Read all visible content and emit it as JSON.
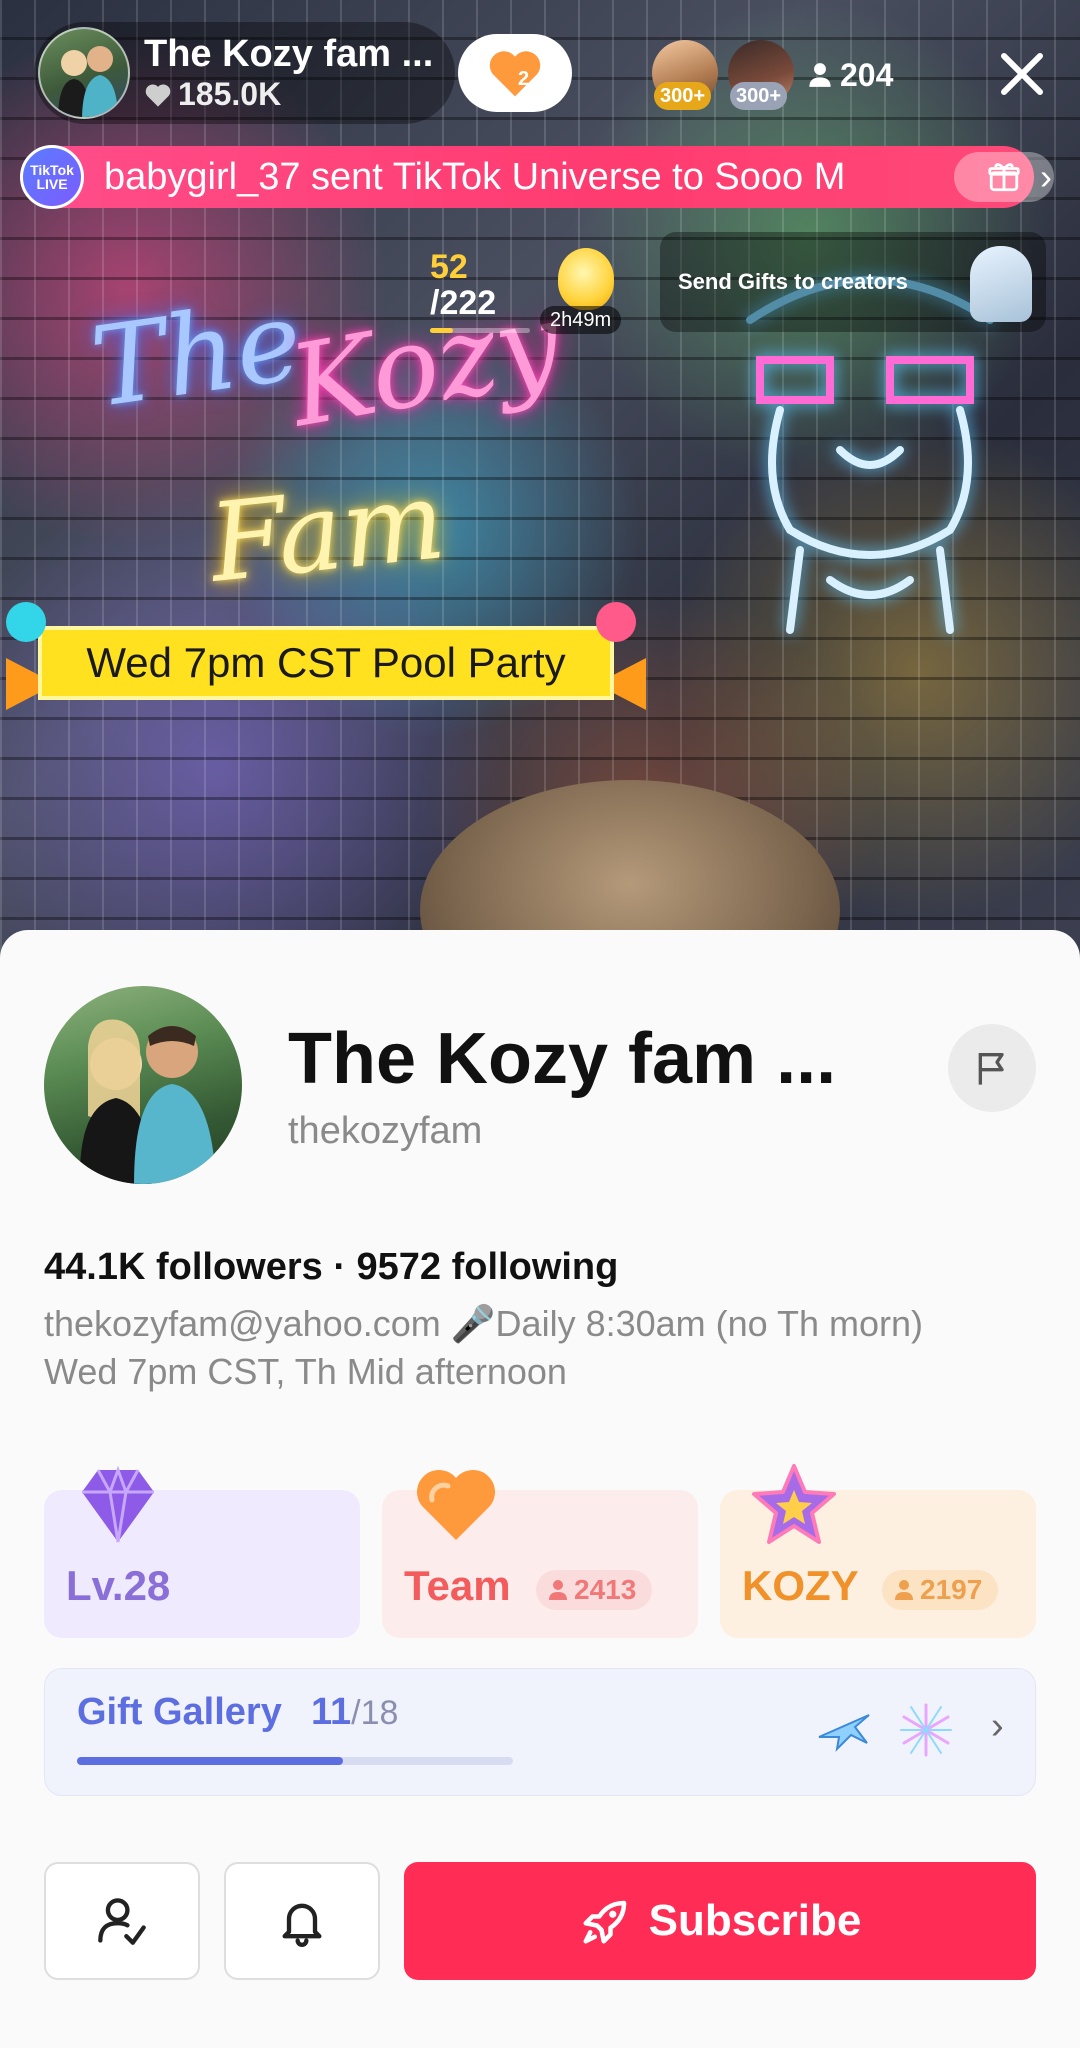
{
  "host": {
    "name": "The Kozy fam ...",
    "likes": "185.0K",
    "follow_count": "2"
  },
  "viewers": {
    "top_badges": [
      "300+",
      "300+"
    ],
    "count": "204"
  },
  "notice": {
    "logo_text": "TikTok LIVE",
    "text": "babygirl_37 sent TikTok Universe to Sooo M"
  },
  "goal": {
    "current": "52",
    "total": "/222",
    "progress": 0.23,
    "time": "2h49m"
  },
  "send_gifts": {
    "label": "Send Gifts to creators"
  },
  "event_banner": {
    "text": "Wed 7pm CST Pool Party"
  },
  "profile": {
    "name": "The Kozy fam ...",
    "handle": "thekozyfam",
    "stats": "44.1K followers · 9572 following",
    "bio_line1": "thekozyfam@yahoo.com 🎤Daily 8:30am (no Th morn)",
    "bio_line2": "Wed 7pm CST, Th Mid afternoon"
  },
  "cards": {
    "level": {
      "label": "Lv.28",
      "color": "#8a6fd8",
      "bg": "#efeafd"
    },
    "team": {
      "label": "Team",
      "count": "2413",
      "color": "#f25c5c",
      "bg": "#fdecec"
    },
    "fan": {
      "label": "KOZY",
      "count": "2197",
      "color": "#f0912a",
      "bg": "#fdf0e0"
    }
  },
  "gallery": {
    "title": "Gift Gallery",
    "count": "11",
    "total": "/18",
    "progress": 0.61
  },
  "actions": {
    "subscribe_label": "Subscribe"
  },
  "colors": {
    "accent": "#ff2c55",
    "banner_pink": "#ff3b6f",
    "event_yellow": "#ffe11f"
  },
  "icons": [
    "heart-icon",
    "person-icon",
    "close-icon",
    "gift-icon",
    "flag-icon",
    "diamond-icon",
    "star-icon",
    "follow-check-icon",
    "bell-icon",
    "rocket-icon"
  ]
}
